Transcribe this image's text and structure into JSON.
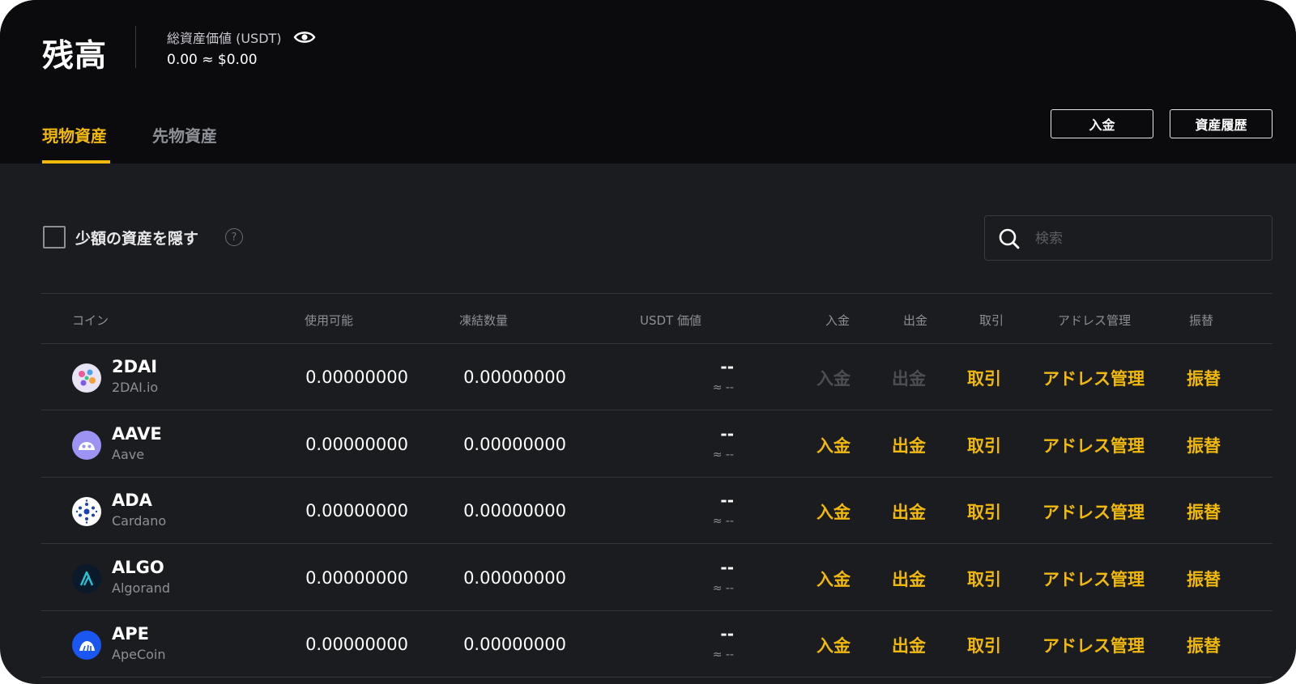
{
  "header": {
    "title": "残高",
    "total_label": "総資産価値 (USDT)",
    "total_value": "0.00 ≈ $0.00",
    "tabs": [
      {
        "label": "現物資産",
        "active": true
      },
      {
        "label": "先物資産",
        "active": false
      }
    ],
    "deposit_button": "入金",
    "history_button": "資産履歴"
  },
  "filters": {
    "hide_small_label": "少額の資産を隠す",
    "help_glyph": "?",
    "search_placeholder": "検索"
  },
  "table": {
    "columns": [
      "コイン",
      "使用可能",
      "凍結数量",
      "USDT 価値",
      "入金",
      "出金",
      "取引",
      "アドレス管理",
      "振替"
    ],
    "rows": [
      {
        "symbol": "2DAI",
        "name": "2DAI.io",
        "available": "0.00000000",
        "frozen": "0.00000000",
        "usdt": "--",
        "usdt_approx": "≈ --",
        "deposit": "入金",
        "withdraw": "出金",
        "trade": "取引",
        "address": "アドレス管理",
        "transfer": "振替",
        "deposit_enabled": false,
        "icon": "2dai-logo-icon",
        "icon_color": "#e9e4f5"
      },
      {
        "symbol": "AAVE",
        "name": "Aave",
        "available": "0.00000000",
        "frozen": "0.00000000",
        "usdt": "--",
        "usdt_approx": "≈ --",
        "deposit": "入金",
        "withdraw": "出金",
        "trade": "取引",
        "address": "アドレス管理",
        "transfer": "振替",
        "deposit_enabled": true,
        "icon": "aave-logo-icon",
        "icon_color": "#9c93f2"
      },
      {
        "symbol": "ADA",
        "name": "Cardano",
        "available": "0.00000000",
        "frozen": "0.00000000",
        "usdt": "--",
        "usdt_approx": "≈ --",
        "deposit": "入金",
        "withdraw": "出金",
        "trade": "取引",
        "address": "アドレス管理",
        "transfer": "振替",
        "deposit_enabled": true,
        "icon": "cardano-logo-icon",
        "icon_color": "#ffffff"
      },
      {
        "symbol": "ALGO",
        "name": "Algorand",
        "available": "0.00000000",
        "frozen": "0.00000000",
        "usdt": "--",
        "usdt_approx": "≈ --",
        "deposit": "入金",
        "withdraw": "出金",
        "trade": "取引",
        "address": "アドレス管理",
        "transfer": "振替",
        "deposit_enabled": true,
        "icon": "algorand-logo-icon",
        "icon_color": "#0b1a2a"
      },
      {
        "symbol": "APE",
        "name": "ApeCoin",
        "available": "0.00000000",
        "frozen": "0.00000000",
        "usdt": "--",
        "usdt_approx": "≈ --",
        "deposit": "入金",
        "withdraw": "出金",
        "trade": "取引",
        "address": "アドレス管理",
        "transfer": "振替",
        "deposit_enabled": true,
        "icon": "apecoin-logo-icon",
        "icon_color": "#1a56f0"
      }
    ]
  },
  "colors": {
    "accent": "#f0b90b",
    "background": "#1b1c20",
    "header_background": "#0b0b0e",
    "muted_text": "#8d8f96"
  }
}
